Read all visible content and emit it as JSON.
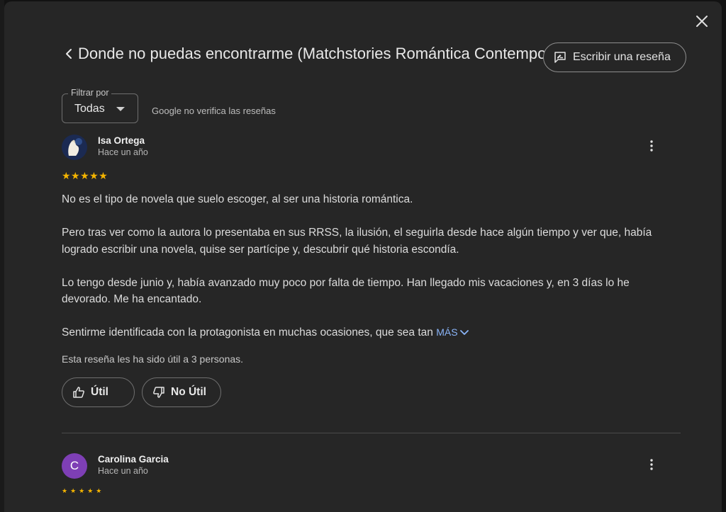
{
  "dialog": {
    "title": "Donde no puedas encontrarme (Matchstories Romántica Contemporánea)",
    "write_review_label": "Escribir una reseña",
    "filter": {
      "legend": "Filtrar por",
      "value": "Todas"
    },
    "disclaimer": "Google no verifica las reseñas"
  },
  "reviews": [
    {
      "author": "Isa Ortega",
      "when": "Hace un año",
      "stars": "★★★★★",
      "paragraphs": [
        "No es el tipo de novela que suelo escoger, al ser una historia romántica.",
        "Pero tras ver como la autora lo presentaba en sus RRSS, la ilusión, el seguirla desde hace algún tiempo y ver que, había logrado escribir una novela, quise ser partícipe y, descubrir qué historia escondía.",
        "Lo tengo desde junio y, había avanzado muy poco por falta de tiempo. Han llegado mis vacaciones y, en 3 días lo he devorado. Me ha encantado.",
        "Sentirme identificada con la protagonista en muchas ocasiones, que sea tan"
      ],
      "more_label": "MÁS",
      "helpful_text": "Esta reseña les ha sido útil a 3 personas.",
      "useful_label": "Útil",
      "not_useful_label": "No Útil"
    },
    {
      "author": "Carolina Garcia",
      "when": "Hace un año",
      "initial": "C",
      "stars": "★★★★★"
    }
  ],
  "colors": {
    "accent_link": "#8ab4f8",
    "star": "#f4b400",
    "avatar_c": "#7e3fb5"
  }
}
